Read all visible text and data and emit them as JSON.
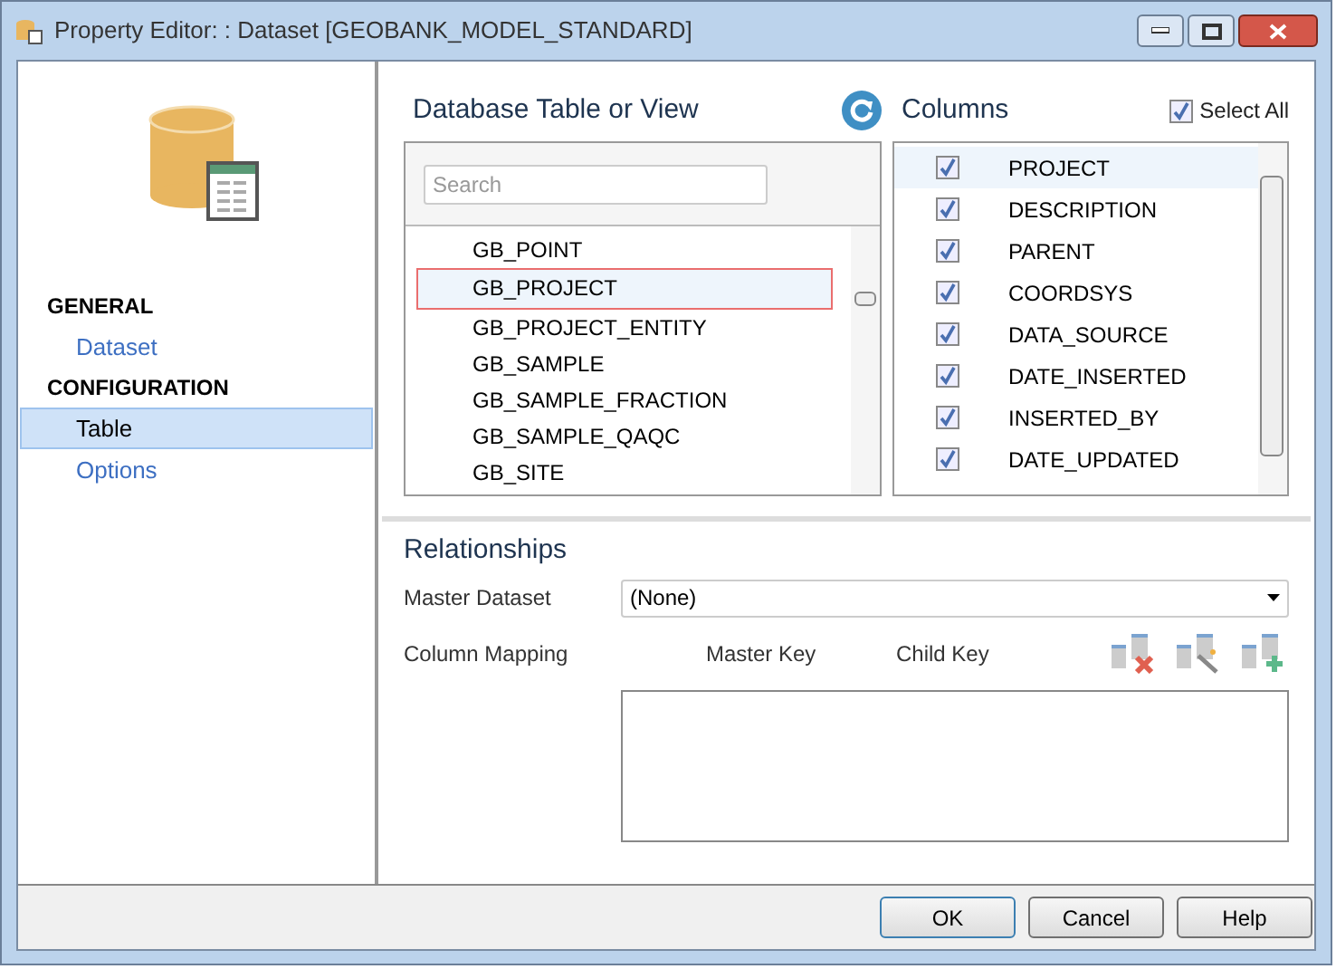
{
  "window": {
    "title": "Property Editor: : Dataset [GEOBANK_MODEL_STANDARD]"
  },
  "sidebar": {
    "sections": [
      {
        "heading": "GENERAL",
        "items": [
          {
            "label": "Dataset",
            "selected": false
          }
        ]
      },
      {
        "heading": "CONFIGURATION",
        "items": [
          {
            "label": "Table",
            "selected": true
          },
          {
            "label": "Options",
            "selected": false
          }
        ]
      }
    ]
  },
  "tables": {
    "title": "Database Table or View",
    "search": {
      "placeholder": "Search"
    },
    "items": [
      {
        "label": "GB_POINT",
        "selected": false
      },
      {
        "label": "GB_PROJECT",
        "selected": true
      },
      {
        "label": "GB_PROJECT_ENTITY",
        "selected": false
      },
      {
        "label": "GB_SAMPLE",
        "selected": false
      },
      {
        "label": "GB_SAMPLE_FRACTION",
        "selected": false
      },
      {
        "label": "GB_SAMPLE_QAQC",
        "selected": false
      },
      {
        "label": "GB_SITE",
        "selected": false
      }
    ]
  },
  "columns": {
    "title": "Columns",
    "select_all": {
      "label": "Select All",
      "checked": true
    },
    "items": [
      {
        "label": "PROJECT",
        "checked": true,
        "selected": true
      },
      {
        "label": "DESCRIPTION",
        "checked": true,
        "selected": false
      },
      {
        "label": "PARENT",
        "checked": true,
        "selected": false
      },
      {
        "label": "COORDSYS",
        "checked": true,
        "selected": false
      },
      {
        "label": "DATA_SOURCE",
        "checked": true,
        "selected": false
      },
      {
        "label": "DATE_INSERTED",
        "checked": true,
        "selected": false
      },
      {
        "label": "INSERTED_BY",
        "checked": true,
        "selected": false
      },
      {
        "label": "DATE_UPDATED",
        "checked": true,
        "selected": false
      }
    ]
  },
  "relationships": {
    "title": "Relationships",
    "master_dataset": {
      "label": "Master Dataset",
      "value": "(None)"
    },
    "column_mapping": {
      "label": "Column Mapping",
      "headers": [
        "Master Key",
        "Child Key"
      ]
    }
  },
  "buttons": [
    {
      "label": "OK",
      "default": true
    },
    {
      "label": "Cancel",
      "default": false
    },
    {
      "label": "Help",
      "default": false
    }
  ]
}
